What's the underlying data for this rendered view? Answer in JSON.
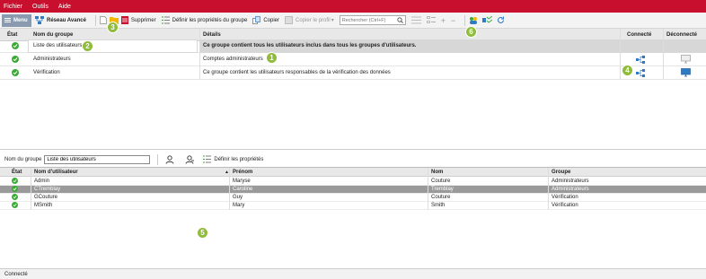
{
  "menubar": {
    "items": [
      "Fichier",
      "Outils",
      "Aide"
    ]
  },
  "toolbar": {
    "menu_label": "Menu",
    "reseau": "Réseau Avancé",
    "supprimer": "Supprimer",
    "definir": "Définir les propriétés du groupe",
    "copier": "Copier",
    "copier_profil": "Copier le profil",
    "search_placeholder": "Rechercher (Ctrl+F)"
  },
  "groups": {
    "headers": {
      "etat": "État",
      "nom": "Nom du groupe",
      "details": "Détails",
      "connecte": "Connecté",
      "deconnecte": "Déconnecté"
    },
    "rows": [
      {
        "nom": "Liste des utilisateurs",
        "details": "Ce groupe contient tous les utilisateurs inclus dans tous les groupes d'utilisateurs."
      },
      {
        "nom": "Administrateurs",
        "details": "Comptes administrateurs"
      },
      {
        "nom": "Vérification",
        "details": "Ce groupe contient les utilisateurs responsables de la vérification des données"
      }
    ]
  },
  "bottom": {
    "group_label": "Nom du groupe",
    "group_value": "Liste des utilisateurs",
    "define_label": "Définir les propriétés"
  },
  "users": {
    "headers": {
      "etat": "État",
      "user": "Nom d'utilisateur",
      "prenom": "Prénom",
      "nom": "Nom",
      "groupe": "Groupe"
    },
    "rows": [
      {
        "user": "Admin",
        "prenom": "Maryse",
        "nom": "Couture",
        "groupe": "Administrateurs"
      },
      {
        "user": "CTremblay",
        "prenom": "Caroline",
        "nom": "Tremblay",
        "groupe": "Administrateurs"
      },
      {
        "user": "GCouture",
        "prenom": "Guy",
        "nom": "Couture",
        "groupe": "Vérification"
      },
      {
        "user": "MSmith",
        "prenom": "Mary",
        "nom": "Smith",
        "groupe": "Vérification"
      }
    ]
  },
  "status": "Connecté",
  "callouts": [
    "1",
    "2",
    "3",
    "4",
    "5",
    "6"
  ],
  "colors": {
    "brand": "#c8102e",
    "ok": "#3aaa35",
    "callout": "#8fbc3a",
    "network": "#2e7bc4"
  }
}
